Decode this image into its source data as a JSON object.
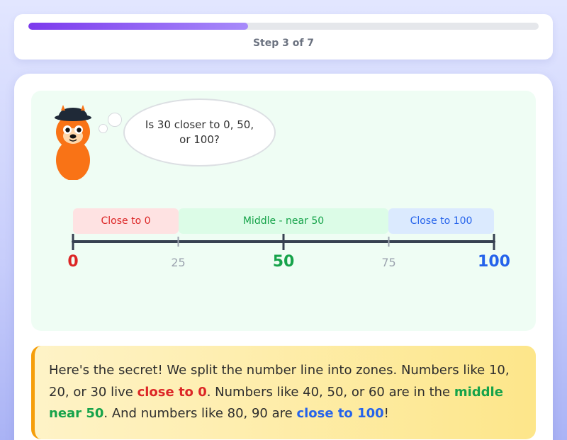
{
  "progress": {
    "value": 0.43,
    "label": "Step 3 of 7"
  },
  "mascot": {
    "icon": "fox-mascot-icon"
  },
  "speech": {
    "text": "Is 30 closer to 0, 50, or 100?"
  },
  "number_line": {
    "min": 0,
    "max": 100,
    "zones": [
      {
        "label": "Close to 0",
        "from": 0,
        "to": 25
      },
      {
        "label": "Middle - near 50",
        "from": 25,
        "to": 75
      },
      {
        "label": "Close to 100",
        "from": 75,
        "to": 100
      }
    ],
    "ticks": [
      {
        "value": 0,
        "label": "0",
        "major": true
      },
      {
        "value": 25,
        "label": "25",
        "major": false
      },
      {
        "value": 50,
        "label": "50",
        "major": true
      },
      {
        "value": 75,
        "label": "75",
        "major": false
      },
      {
        "value": 100,
        "label": "100",
        "major": true
      }
    ]
  },
  "explanation": {
    "part1": "Here's the secret! We split the number line into zones. Numbers like 10, 20, or 30 live ",
    "hl1": "close to 0",
    "part2": ". Numbers like 40, 50, or 60 are in the ",
    "hl2": "middle near 50",
    "part3": ". And numbers like 80, 90 are ",
    "hl3": "close to 100",
    "part4": "!"
  },
  "colors": {
    "progress_start": "#7c3aed",
    "progress_end": "#a78bfa",
    "zero": "#dc2626",
    "middle": "#16a34a",
    "hundred": "#2563eb",
    "tip_accent": "#f59e0b",
    "scene_bg": "#effdf4"
  }
}
